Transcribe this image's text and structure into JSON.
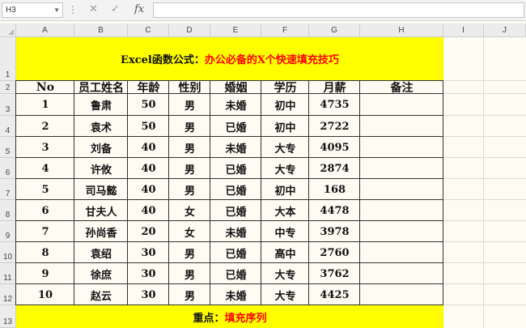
{
  "formula_bar": {
    "name_box": "H3",
    "cancel_icon": "✕",
    "enter_icon": "✓",
    "fx_label": "fx",
    "formula": ""
  },
  "columns": [
    "A",
    "B",
    "C",
    "D",
    "E",
    "F",
    "G",
    "H",
    "I",
    "J"
  ],
  "rows": [
    "1",
    "2",
    "3",
    "4",
    "5",
    "6",
    "7",
    "8",
    "9",
    "10",
    "11",
    "12",
    "13"
  ],
  "title": {
    "part1": "Excel函数公式：",
    "part2": "办公必备的X个快速填充技巧"
  },
  "headers": [
    "No",
    "员工姓名",
    "年龄",
    "性别",
    "婚姻",
    "学历",
    "月薪",
    "备注"
  ],
  "table_rows": [
    [
      "1",
      "鲁肃",
      "50",
      "男",
      "未婚",
      "初中",
      "4735",
      ""
    ],
    [
      "2",
      "袁术",
      "50",
      "男",
      "已婚",
      "初中",
      "2722",
      ""
    ],
    [
      "3",
      "刘备",
      "40",
      "男",
      "未婚",
      "大专",
      "4095",
      ""
    ],
    [
      "4",
      "许攸",
      "40",
      "男",
      "已婚",
      "大专",
      "2874",
      ""
    ],
    [
      "5",
      "司马懿",
      "40",
      "男",
      "已婚",
      "初中",
      "168",
      ""
    ],
    [
      "6",
      "甘夫人",
      "40",
      "女",
      "已婚",
      "大本",
      "4478",
      ""
    ],
    [
      "7",
      "孙尚香",
      "20",
      "女",
      "未婚",
      "中专",
      "3978",
      ""
    ],
    [
      "8",
      "袁绍",
      "30",
      "男",
      "已婚",
      "高中",
      "2760",
      ""
    ],
    [
      "9",
      "徐庶",
      "30",
      "男",
      "已婚",
      "大专",
      "3762",
      ""
    ],
    [
      "10",
      "赵云",
      "30",
      "男",
      "未婚",
      "大专",
      "4425",
      ""
    ]
  ],
  "footer": {
    "part1": "重点：",
    "part2": "填充序列"
  },
  "colors": {
    "highlight": "#ffff00",
    "accent_text": "#ff0000"
  }
}
